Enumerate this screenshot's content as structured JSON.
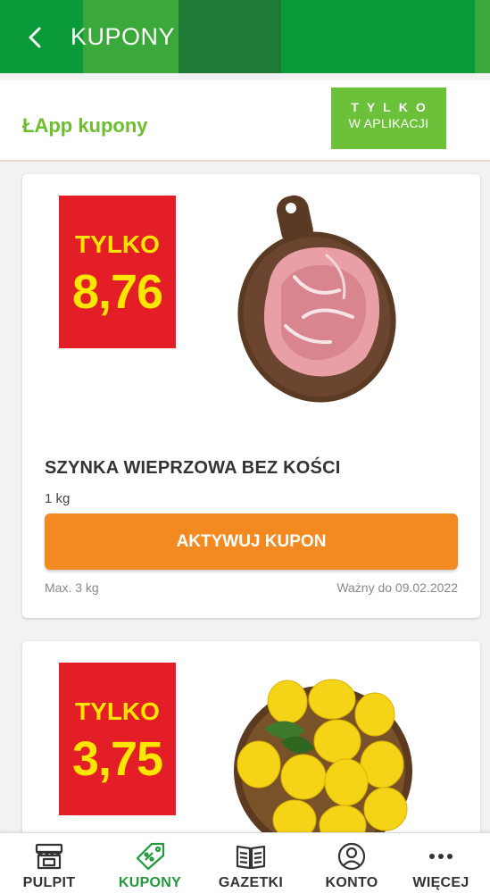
{
  "header": {
    "title": "KUPONY",
    "back_icon": "chevron-left-icon",
    "color": "#0a9a3a"
  },
  "subheader": {
    "label": "ŁApp kupony",
    "badge_line1": "TYLKO",
    "badge_line2": "W APLIKACJI",
    "accent_color": "#6cc13a"
  },
  "coupons": [
    {
      "price_label": "TYLKO",
      "price": "8,76",
      "image": "pork-ham-on-board",
      "name": "SZYNKA WIEPRZOWA BEZ KOŚCI",
      "quantity": "1 kg",
      "button_label": "AKTYWUJ KUPON",
      "max": "Max. 3 kg",
      "valid": "Ważny do 09.02.2022"
    },
    {
      "price_label": "TYLKO",
      "price": "3,75",
      "image": "lemons-in-basket"
    }
  ],
  "bottom_nav": {
    "items": [
      {
        "label": "PULPIT",
        "icon": "store-icon",
        "active": false
      },
      {
        "label": "KUPONY",
        "icon": "coupon-tag-icon",
        "active": true
      },
      {
        "label": "GAZETKI",
        "icon": "newspaper-icon",
        "active": false
      },
      {
        "label": "KONTO",
        "icon": "user-circle-icon",
        "active": false
      },
      {
        "label": "WIĘCEJ",
        "icon": "more-dots-icon",
        "active": false
      }
    ],
    "active_color": "#1f9a3a"
  },
  "colors": {
    "price_tag_bg": "#e41e26",
    "price_text": "#ffe600",
    "button": "#f28a21"
  }
}
